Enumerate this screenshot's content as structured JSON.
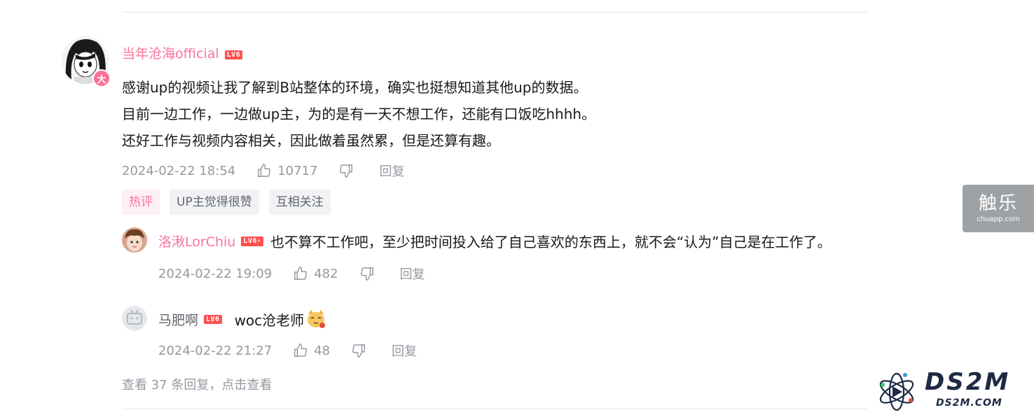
{
  "main_comment": {
    "username": "当年沧海official",
    "level": "LV6",
    "avatar_badge": "大",
    "lines": [
      "感谢up的视频让我了解到B站整体的环境，确实也挺想知道其他up的数据。",
      "目前一边工作，一边做up主，为的是有一天不想工作，还能有口饭吃hhhh。",
      "还好工作与视频内容相关，因此做着虽然累，但是还算有趣。"
    ],
    "time": "2024-02-22 18:54",
    "likes": "10717",
    "reply_label": "回复",
    "tags": [
      "热评",
      "UP主觉得很赞",
      "互相关注"
    ]
  },
  "replies": [
    {
      "username": "洛湫LorChiu",
      "level": "LV6",
      "content": "也不算不工作吧，至少把时间投入给了自己喜欢的东西上，就不会“认为”自己是在工作了。",
      "time": "2024-02-22 19:09",
      "likes": "482",
      "reply_label": "回复"
    },
    {
      "username": "马肥啊",
      "level": "LV6",
      "content": "woc沧老师",
      "time": "2024-02-22 21:27",
      "likes": "48",
      "reply_label": "回复"
    }
  ],
  "view_more": "查看 37 条回复，点击查看",
  "side_brand": {
    "name": "触乐",
    "url": "chuapp.com"
  },
  "watermark": {
    "name": "DS2M",
    "url": "DS2M.COM"
  },
  "colors": {
    "accent": "#fb7299",
    "meta": "#9499a0",
    "level": "#ff4f4f"
  }
}
